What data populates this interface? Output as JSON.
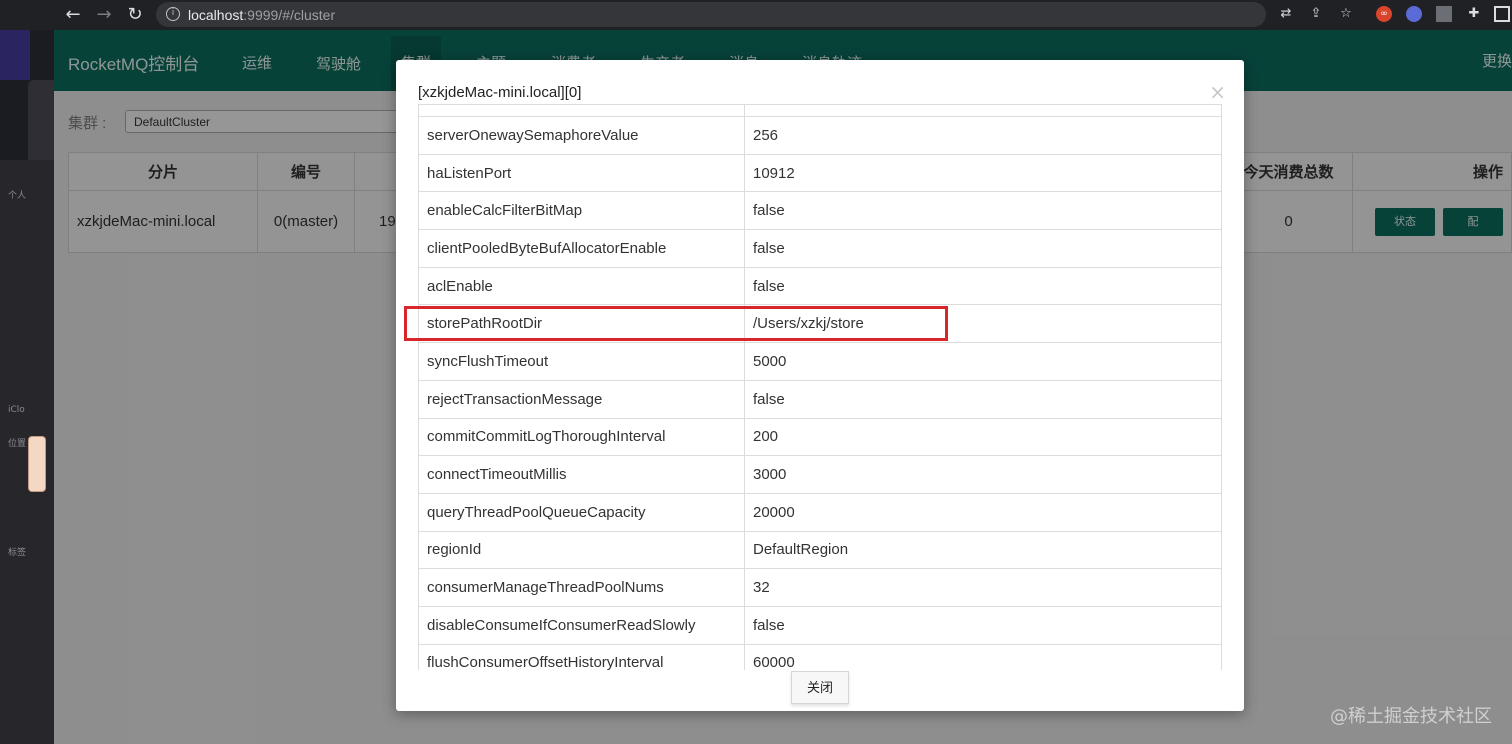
{
  "browser": {
    "url_host": "localhost",
    "url_rest": ":9999/#/cluster"
  },
  "app": {
    "brand": "RocketMQ控制台",
    "nav": [
      "运维",
      "驾驶舱",
      "集群",
      "主题",
      "消费者",
      "生产者",
      "消息",
      "消息轨迹"
    ],
    "lang": "更换",
    "cluster_label": "集群 :",
    "cluster_value": "DefaultCluster"
  },
  "table": {
    "headers": [
      "分片",
      "编号",
      "",
      "数",
      "今天消费总数",
      "操作"
    ],
    "row": {
      "shard": "xzkjdeMac-mini.local",
      "id": "0(master)",
      "addr_partial": "19",
      "consumed_today": "0",
      "status_btn": "状态",
      "config_btn_partial": "配"
    }
  },
  "modal": {
    "title": "[xzkjdeMac-mini.local][0]",
    "close_glyph": "×",
    "close_button": "关闭",
    "rows": [
      {
        "key": "serverOnewaySemaphoreValue",
        "value": "256"
      },
      {
        "key": "haListenPort",
        "value": "10912"
      },
      {
        "key": "enableCalcFilterBitMap",
        "value": "false"
      },
      {
        "key": "clientPooledByteBufAllocatorEnable",
        "value": "false"
      },
      {
        "key": "aclEnable",
        "value": "false"
      },
      {
        "key": "storePathRootDir",
        "value": "/Users/xzkj/store"
      },
      {
        "key": "syncFlushTimeout",
        "value": "5000"
      },
      {
        "key": "rejectTransactionMessage",
        "value": "false"
      },
      {
        "key": "commitCommitLogThoroughInterval",
        "value": "200"
      },
      {
        "key": "connectTimeoutMillis",
        "value": "3000"
      },
      {
        "key": "queryThreadPoolQueueCapacity",
        "value": "20000"
      },
      {
        "key": "regionId",
        "value": "DefaultRegion"
      },
      {
        "key": "consumerManageThreadPoolNums",
        "value": "32"
      },
      {
        "key": "disableConsumeIfConsumerReadSlowly",
        "value": "false"
      },
      {
        "key": "flushConsumerOffsetHistoryInterval",
        "value": "60000"
      }
    ]
  },
  "watermark": "@稀土掘金技术社区",
  "desktop": {
    "labels": [
      "个人",
      "iClo",
      "位置",
      "标签"
    ]
  }
}
